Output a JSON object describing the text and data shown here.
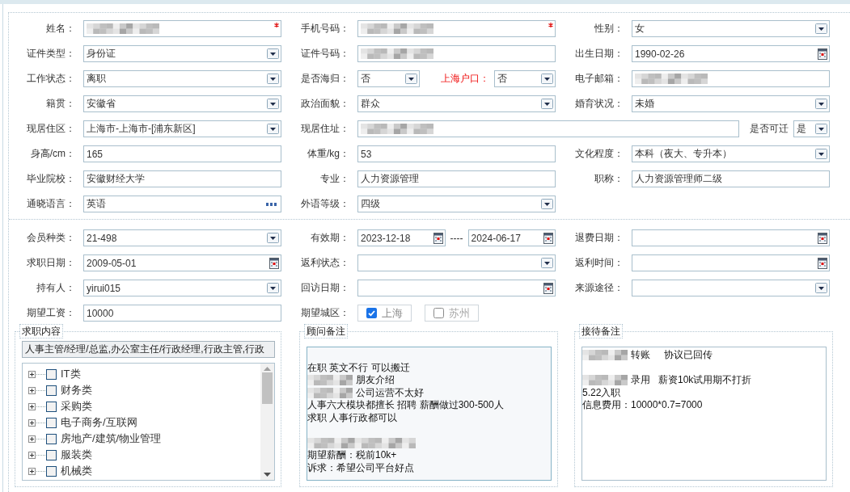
{
  "basic_info": {
    "rows": [
      [
        {
          "fields": [
            {
              "label": "姓名：",
              "kind": "text",
              "redacted": true,
              "required": true
            }
          ]
        },
        {
          "fields": [
            {
              "label": "手机号码：",
              "kind": "text",
              "redacted": true,
              "required": true
            }
          ]
        },
        {
          "fields": [
            {
              "label": "性别：",
              "kind": "select",
              "value": "女"
            }
          ]
        }
      ],
      [
        {
          "fields": [
            {
              "label": "证件类型：",
              "kind": "select",
              "value": "身份证"
            }
          ]
        },
        {
          "fields": [
            {
              "label": "证件号码：",
              "kind": "text",
              "redacted": true
            }
          ]
        },
        {
          "fields": [
            {
              "label": "出生日期：",
              "kind": "date",
              "value": "1990-02-26"
            }
          ]
        }
      ],
      [
        {
          "fields": [
            {
              "label": "工作状态：",
              "kind": "select",
              "value": "离职"
            }
          ]
        },
        {
          "fields": [
            {
              "label": "是否海归：",
              "kind": "select",
              "value": "否",
              "alert": false
            },
            {
              "label": "上海户口：",
              "kind": "select",
              "value": "否",
              "alert": true
            }
          ]
        },
        {
          "fields": [
            {
              "label": "电子邮箱：",
              "kind": "text",
              "redacted": true
            }
          ]
        }
      ],
      [
        {
          "fields": [
            {
              "label": "籍贯：",
              "kind": "select",
              "value": "安徽省"
            }
          ]
        },
        {
          "fields": [
            {
              "label": "政治面貌：",
              "kind": "select",
              "value": "群众"
            }
          ]
        },
        {
          "fields": [
            {
              "label": "婚育状况：",
              "kind": "select",
              "value": "未婚"
            }
          ]
        }
      ],
      [
        {
          "fields": [
            {
              "label": "现居住区：",
              "kind": "select",
              "value": "上海市-上海市-[浦东新区]"
            }
          ]
        },
        {
          "wide": true,
          "fields": [
            {
              "label": "现居住址：",
              "kind": "text",
              "redacted": true
            },
            {
              "label": "是否可迁",
              "kind": "select",
              "value": "是"
            }
          ]
        }
      ],
      [
        {
          "fields": [
            {
              "label": "身高/cm：",
              "kind": "text",
              "value": "165"
            }
          ]
        },
        {
          "fields": [
            {
              "label": "体重/kg：",
              "kind": "text",
              "value": "53"
            }
          ]
        },
        {
          "fields": [
            {
              "label": "文化程度：",
              "kind": "select",
              "value": "本科（夜大、专升本）"
            }
          ]
        }
      ],
      [
        {
          "fields": [
            {
              "label": "毕业院校：",
              "kind": "text",
              "value": "安徽财经大学"
            }
          ]
        },
        {
          "fields": [
            {
              "label": "专业：",
              "kind": "text",
              "value": "人力资源管理"
            }
          ]
        },
        {
          "fields": [
            {
              "label": "职称：",
              "kind": "text",
              "value": "人力资源管理师二级"
            }
          ]
        }
      ],
      [
        {
          "fields": [
            {
              "label": "通晓语言：",
              "kind": "lookup",
              "value": "英语"
            }
          ]
        },
        {
          "fields": [
            {
              "label": "外语等级：",
              "kind": "select",
              "value": "四级"
            }
          ]
        }
      ]
    ]
  },
  "membership": {
    "rows": [
      [
        {
          "fields": [
            {
              "label": "会员种类：",
              "kind": "select",
              "value": "21-498"
            }
          ]
        },
        {
          "fields": [
            {
              "label": "有效期：",
              "kind": "date_range",
              "from": "2023-12-18",
              "separator": "----",
              "to": "2024-06-17"
            }
          ]
        },
        {
          "fields": [
            {
              "label": "退费日期：",
              "kind": "date"
            }
          ]
        }
      ],
      [
        {
          "fields": [
            {
              "label": "求职日期：",
              "kind": "date",
              "value": "2009-05-01"
            }
          ]
        },
        {
          "fields": [
            {
              "label": "返利状态：",
              "kind": "select"
            }
          ]
        },
        {
          "fields": [
            {
              "label": "返利时间：",
              "kind": "date"
            }
          ]
        }
      ],
      [
        {
          "fields": [
            {
              "label": "持有人：",
              "kind": "select",
              "value": "yirui015"
            }
          ]
        },
        {
          "fields": [
            {
              "label": "回访日期：",
              "kind": "date"
            }
          ]
        },
        {
          "fields": [
            {
              "label": "来源途径：",
              "kind": "select"
            }
          ]
        }
      ],
      [
        {
          "fields": [
            {
              "label": "期望工资：",
              "kind": "text",
              "value": "10000"
            }
          ]
        },
        {
          "fields": [
            {
              "label": "期望城区：",
              "kind": "checkboxes",
              "options": [
                {
                  "label": "上海",
                  "checked": true
                },
                {
                  "label": "苏州",
                  "checked": false
                }
              ]
            }
          ]
        }
      ]
    ]
  },
  "job_intent": {
    "legend": "求职内容",
    "summary": "人事主管/经理/总监,办公室主任/行政经理,行政主管,行政",
    "tree": [
      {
        "label": "IT类",
        "expanded": false,
        "checked": false
      },
      {
        "label": "财务类",
        "expanded": false,
        "checked": false
      },
      {
        "label": "采购类",
        "expanded": false,
        "checked": false
      },
      {
        "label": "电子商务/互联网",
        "expanded": false,
        "checked": false
      },
      {
        "label": "房地产/建筑/物业管理",
        "expanded": false,
        "checked": false
      },
      {
        "label": "服装类",
        "expanded": false,
        "checked": false
      },
      {
        "label": "机械类",
        "expanded": false,
        "checked": false
      }
    ]
  },
  "consultant_note": {
    "legend": "顾问备注",
    "lines": [
      {
        "text": "在职 英文不行 可以搬迁",
        "gap_before": true,
        "redacted": false
      },
      {
        "text": "朋友介绍",
        "gap_before": false,
        "redacted": true
      },
      {
        "text": "公司运营不太好",
        "gap_before": false,
        "redacted": true
      },
      {
        "text": "人事六大模块都擅长 招聘 薪酬做过300-500人",
        "gap_before": false,
        "redacted": false
      },
      {
        "text": "求职 人事行政都可以",
        "gap_before": false,
        "redacted": false
      },
      {
        "gap_before": true,
        "redacted": true
      },
      {
        "text": "期望薪酬：税前10k+",
        "gap_before": false,
        "redacted": false
      },
      {
        "text": "诉求：希望公司平台好点",
        "gap_before": false,
        "redacted": false
      }
    ]
  },
  "reception_note": {
    "legend": "接待备注",
    "lines": [
      {
        "text": "转账     协议已回传",
        "gap_before": false,
        "redacted": true
      },
      {
        "text": "录用   薪资10k试用期不打折",
        "gap_before": true,
        "redacted": true
      },
      {
        "text": "5.22入职",
        "gap_before": false,
        "redacted": false
      },
      {
        "text": "信息费用：10000*0.7=7000",
        "gap_before": false,
        "redacted": false
      }
    ]
  }
}
